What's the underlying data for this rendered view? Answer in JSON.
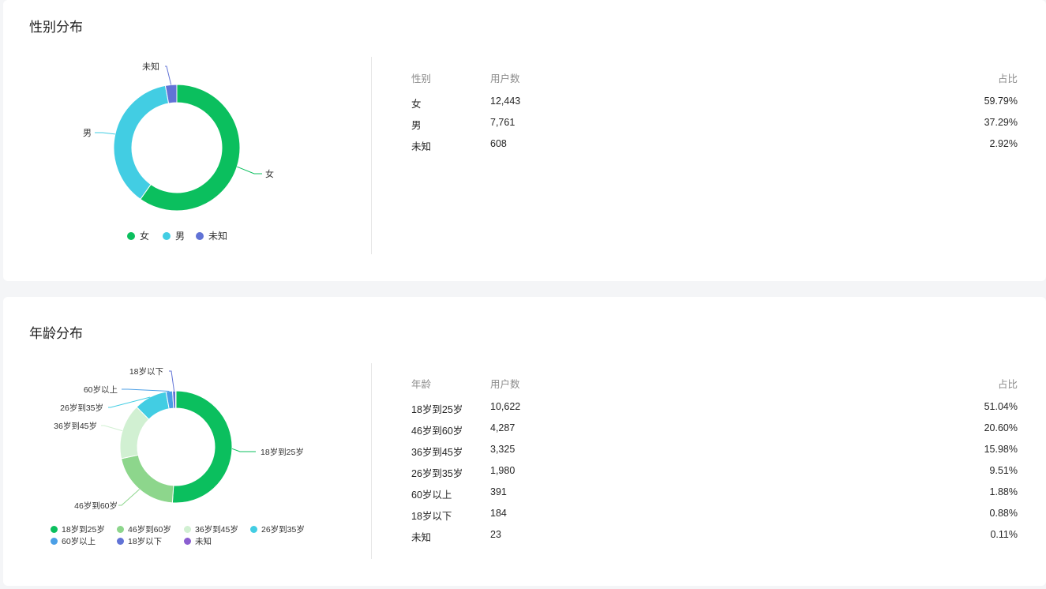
{
  "gender": {
    "title": "性别分布",
    "headers": {
      "col1": "性别",
      "col2": "用户数",
      "col3": "占比"
    },
    "rows": [
      {
        "label": "女",
        "count": "12,443",
        "pct": "59.79%"
      },
      {
        "label": "男",
        "count": "7,761",
        "pct": "37.29%"
      },
      {
        "label": "未知",
        "count": "608",
        "pct": "2.92%"
      }
    ],
    "legend": [
      "女",
      "男",
      "未知"
    ]
  },
  "age": {
    "title": "年龄分布",
    "headers": {
      "col1": "年龄",
      "col2": "用户数",
      "col3": "占比"
    },
    "rows": [
      {
        "label": "18岁到25岁",
        "count": "10,622",
        "pct": "51.04%"
      },
      {
        "label": "46岁到60岁",
        "count": "4,287",
        "pct": "20.60%"
      },
      {
        "label": "36岁到45岁",
        "count": "3,325",
        "pct": "15.98%"
      },
      {
        "label": "26岁到35岁",
        "count": "1,980",
        "pct": "9.51%"
      },
      {
        "label": "60岁以上",
        "count": "391",
        "pct": "1.88%"
      },
      {
        "label": "18岁以下",
        "count": "184",
        "pct": "0.88%"
      },
      {
        "label": "未知",
        "count": "23",
        "pct": "0.11%"
      }
    ],
    "legend": [
      "18岁到25岁",
      "46岁到60岁",
      "36岁到45岁",
      "26岁到35岁",
      "60岁以上",
      "18岁以下",
      "未知"
    ]
  },
  "chart_data": [
    {
      "type": "pie",
      "variant": "donut",
      "categories": [
        "女",
        "男",
        "未知"
      ],
      "values": [
        12443,
        7761,
        608
      ],
      "colors": [
        "#0bbf5e",
        "#42cde3",
        "#6173d6"
      ],
      "legend": "bottom"
    },
    {
      "type": "pie",
      "variant": "donut",
      "categories": [
        "18岁到25岁",
        "46岁到60岁",
        "36岁到45岁",
        "26岁到35岁",
        "60岁以上",
        "18岁以下",
        "未知"
      ],
      "values": [
        10622,
        4287,
        3325,
        1980,
        391,
        184,
        23
      ],
      "colors": [
        "#0bbf5e",
        "#8dd68c",
        "#d1f0d2",
        "#42cde3",
        "#4b9fe6",
        "#6173d6",
        "#8b5fd0"
      ],
      "legend": "bottom"
    }
  ]
}
